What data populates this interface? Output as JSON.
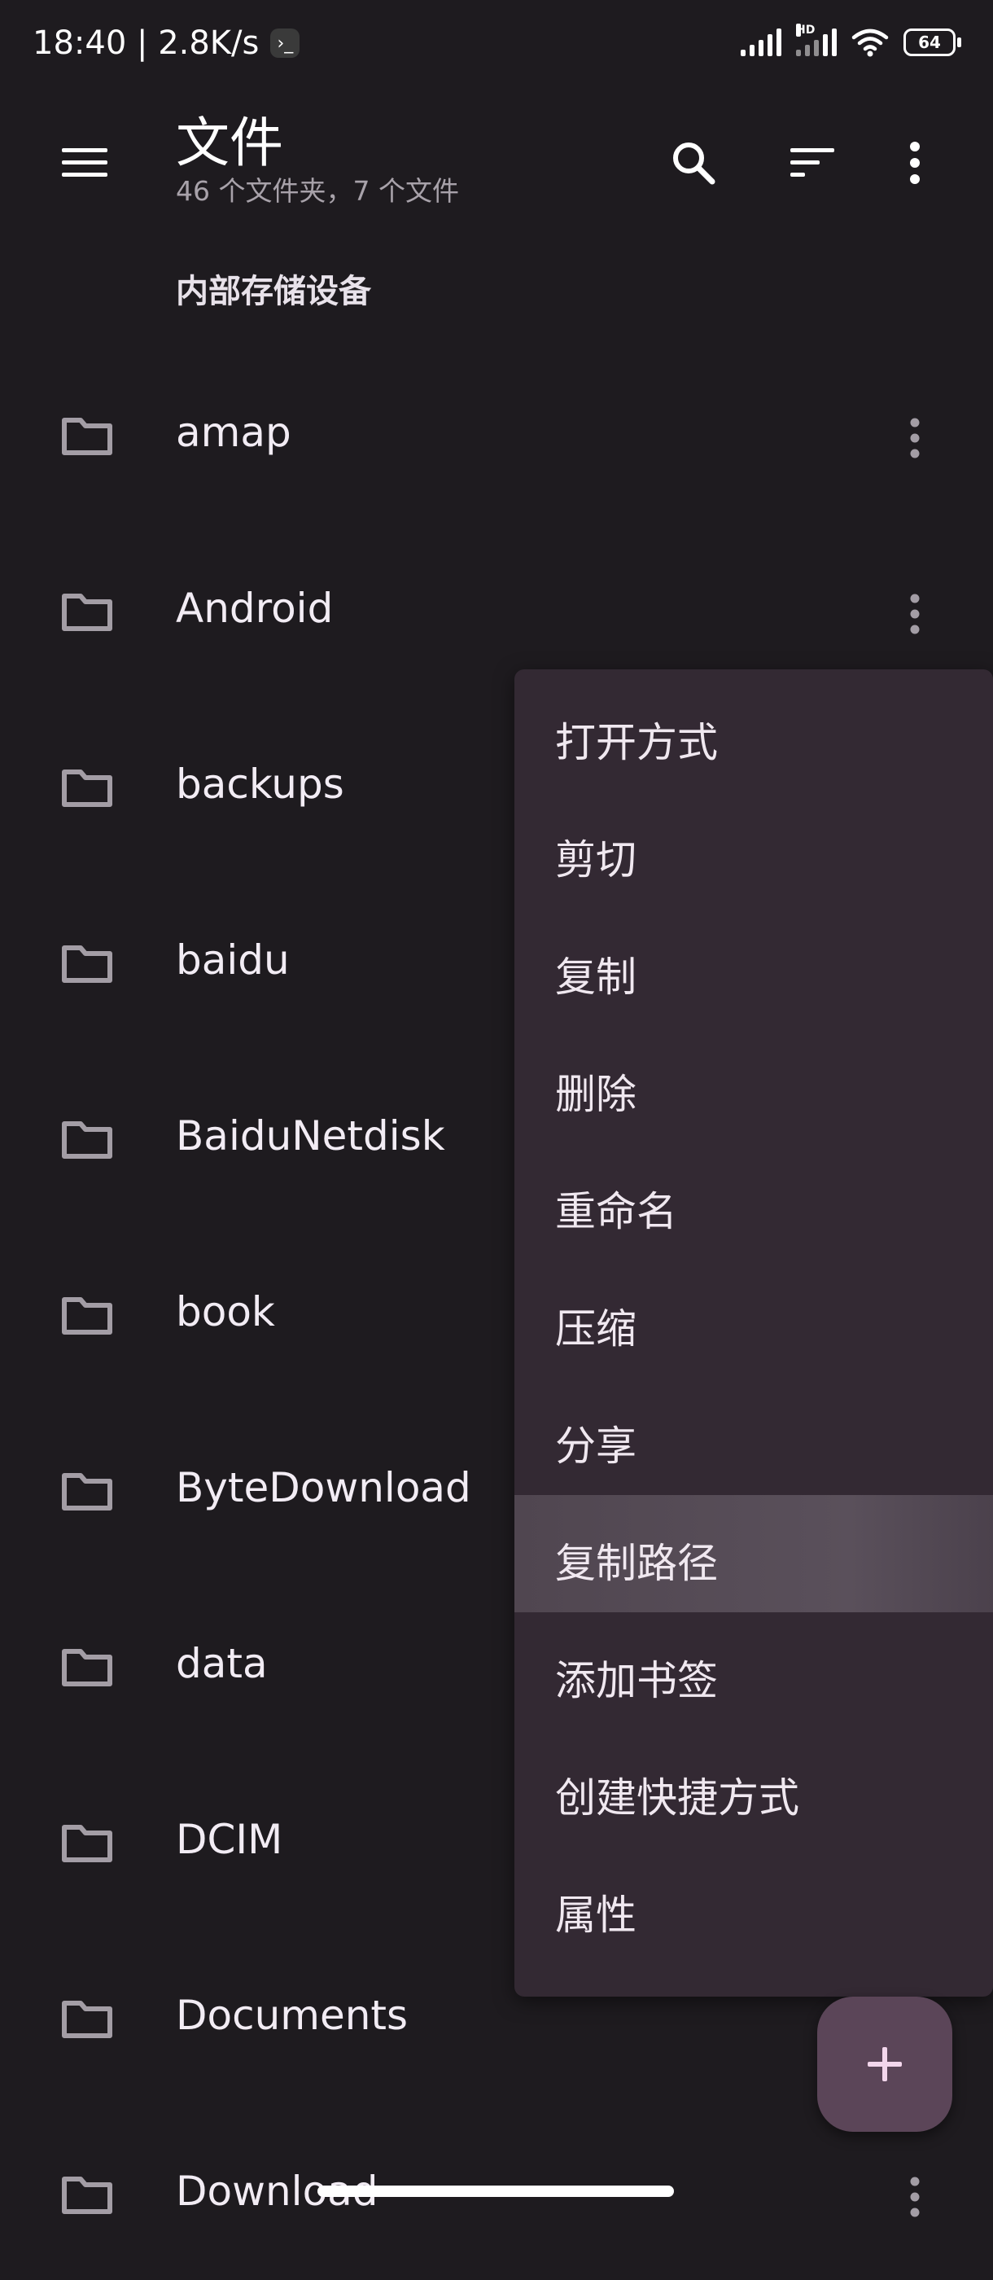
{
  "status_bar": {
    "time": "18:40",
    "net_speed": "2.8K/s",
    "term_glyph": "›_",
    "hd_label": "HD",
    "battery": "64"
  },
  "app_bar": {
    "title": "文件",
    "subtitle": "46 个文件夹，7 个文件"
  },
  "section_header": "内部存储设备",
  "files": [
    "amap",
    "Android",
    "backups",
    "baidu",
    "BaiduNetdisk",
    "book",
    "ByteDownload",
    "data",
    "DCIM",
    "Documents",
    "Download"
  ],
  "context_menu": {
    "items": [
      "打开方式",
      "剪切",
      "复制",
      "删除",
      "重命名",
      "压缩",
      "分享",
      "复制路径",
      "添加书签",
      "创建快捷方式",
      "属性"
    ],
    "highlighted_index": 7
  },
  "icons": {
    "menu": "hamburger-menu-icon",
    "search": "search-icon",
    "sort": "sort-icon",
    "overflow": "more-vertical-icon",
    "folder": "folder-icon",
    "fab": "plus-icon"
  },
  "colors": {
    "background": "#1E1B1F",
    "menu_surface": "#332933",
    "menu_highlight": "#554B56",
    "fab": "#5B4558",
    "fab_icon": "#F3D6EC"
  }
}
